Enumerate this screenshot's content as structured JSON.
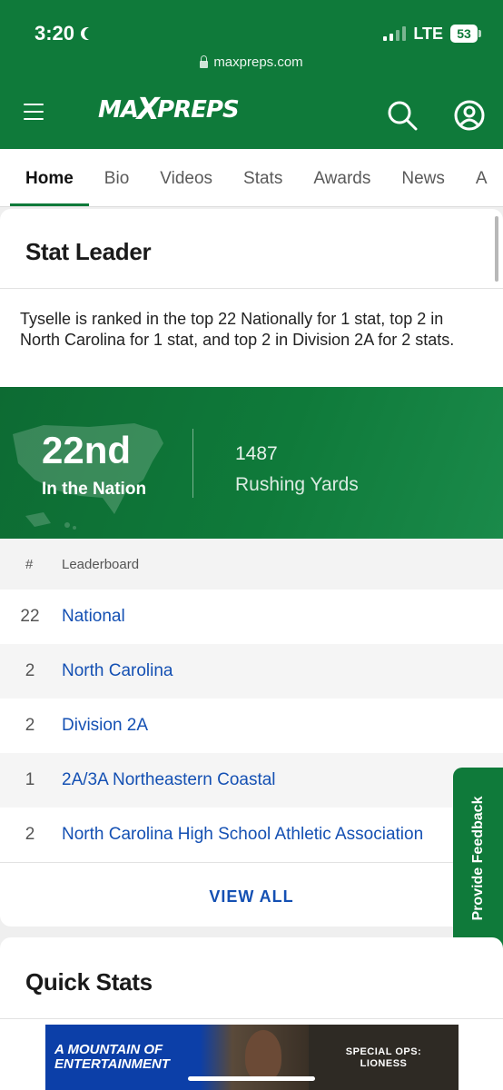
{
  "status": {
    "time": "3:20",
    "network": "LTE",
    "battery": "53"
  },
  "browser": {
    "url": "maxpreps.com"
  },
  "header": {
    "logo": "MAXPREPS"
  },
  "tabs": [
    "Home",
    "Bio",
    "Videos",
    "Stats",
    "Awards",
    "News",
    "A"
  ],
  "stat_leader": {
    "title": "Stat Leader",
    "summary": "Tyselle is ranked in the top 22 Nationally for 1 stat, top 2 in North Carolina for 1 stat, and top 2 in Division 2A for 2 stats.",
    "rank": "22nd",
    "rank_sub": "In the Nation",
    "stat_value": "1487",
    "stat_label": "Rushing Yards",
    "table": {
      "col_rank": "#",
      "col_board": "Leaderboard",
      "rows": [
        {
          "rank": "22",
          "board": "National"
        },
        {
          "rank": "2",
          "board": "North Carolina"
        },
        {
          "rank": "2",
          "board": "Division 2A"
        },
        {
          "rank": "1",
          "board": "2A/3A Northeastern Coastal"
        },
        {
          "rank": "2",
          "board": "North Carolina High School Athletic Association"
        }
      ]
    },
    "view_all": "VIEW ALL"
  },
  "feedback": "Provide Feedback",
  "quick_stats": {
    "title": "Quick Stats"
  },
  "ad": {
    "left_line1": "A MOUNTAIN OF",
    "left_line2": "ENTERTAINMENT",
    "right_line1": "SPECIAL OPS:",
    "right_line2": "LIONESS"
  },
  "colors": {
    "brand_green": "#0f7a3a",
    "link_blue": "#1450b3"
  }
}
